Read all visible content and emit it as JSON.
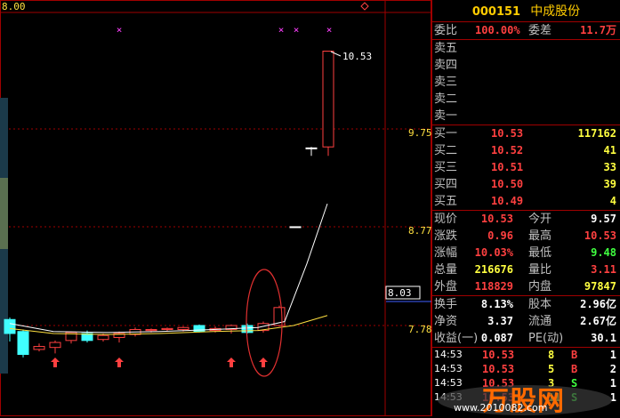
{
  "chart": {
    "top_label": "8.00",
    "price_levels": [
      {
        "label": "9.75",
        "y": 9.75
      },
      {
        "label": "8.77",
        "y": 8.77
      },
      {
        "label": "7.78",
        "y": 7.78
      }
    ],
    "current_price_marker": "8.03",
    "max_annotation": "10.53",
    "colors": {
      "up": "#ff4040",
      "down": "#40ffff",
      "ma_white": "#ffffff",
      "ma_yellow": "#ffe040",
      "grid": "#a00000"
    }
  },
  "quote": {
    "code": "000151",
    "name": "中成股份",
    "weibi_label": "委比",
    "weibi_value": "100.00%",
    "weicha_label": "委差",
    "weicha_value": "11.7万",
    "sell": [
      {
        "label": "卖五",
        "price": "",
        "vol": ""
      },
      {
        "label": "卖四",
        "price": "",
        "vol": ""
      },
      {
        "label": "卖三",
        "price": "",
        "vol": ""
      },
      {
        "label": "卖二",
        "price": "",
        "vol": ""
      },
      {
        "label": "卖一",
        "price": "",
        "vol": ""
      }
    ],
    "buy": [
      {
        "label": "买一",
        "price": "10.53",
        "vol": "117162"
      },
      {
        "label": "买二",
        "price": "10.52",
        "vol": "41"
      },
      {
        "label": "买三",
        "price": "10.51",
        "vol": "33"
      },
      {
        "label": "买四",
        "price": "10.50",
        "vol": "39"
      },
      {
        "label": "买五",
        "price": "10.49",
        "vol": "4"
      }
    ],
    "stats": [
      {
        "l1": "现价",
        "v1": "10.53",
        "l2": "今开",
        "v2": "9.57"
      },
      {
        "l1": "涨跌",
        "v1": "0.96",
        "l2": "最高",
        "v2": "10.53"
      },
      {
        "l1": "涨幅",
        "v1": "10.03%",
        "l2": "最低",
        "v2": "9.48"
      },
      {
        "l1": "总量",
        "v1": "216676",
        "l2": "量比",
        "v2": "3.11"
      },
      {
        "l1": "外盘",
        "v1": "118829",
        "l2": "内盘",
        "v2": "97847"
      }
    ],
    "stats2": [
      {
        "l1": "换手",
        "v1": "8.13%",
        "l2": "股本",
        "v2": "2.96亿"
      },
      {
        "l1": "净资",
        "v1": "3.37",
        "l2": "流通",
        "v2": "2.67亿"
      },
      {
        "l1": "收益(一)",
        "v1": "0.087",
        "l2": "PE(动)",
        "v2": "30.1"
      }
    ],
    "ticks": [
      {
        "time": "14:53",
        "price": "10.53",
        "vol": "8",
        "flag": "B",
        "n": "1"
      },
      {
        "time": "14:53",
        "price": "10.53",
        "vol": "5",
        "flag": "B",
        "n": "2"
      },
      {
        "time": "14:53",
        "price": "10.53",
        "vol": "3",
        "flag": "S",
        "n": "1"
      },
      {
        "time": "14:53",
        "price": "10.53",
        "vol": "11",
        "flag": "S",
        "n": "1"
      }
    ]
  },
  "watermark": {
    "text": "万股网",
    "url": "www.2010082.com"
  }
}
